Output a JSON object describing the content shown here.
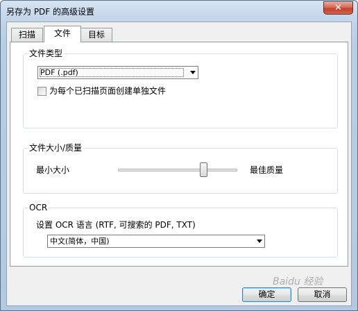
{
  "window": {
    "title": "另存为 PDF 的高级设置",
    "close_label": "✕"
  },
  "tabs": [
    {
      "label": "扫描"
    },
    {
      "label": "文件"
    },
    {
      "label": "目标"
    }
  ],
  "file_type": {
    "group_label": "文件类型",
    "select_value": "PDF (.pdf)",
    "checkbox_label": "为每个已扫描页面创建单独文件",
    "checkbox_checked": false
  },
  "size_quality": {
    "group_label": "文件大小/质量",
    "min_label": "最小大小",
    "max_label": "最佳质量",
    "slider_fraction": 0.72
  },
  "ocr": {
    "group_label": "OCR",
    "language_label": "设置 OCR 语言 (RTF, 可搜索的 PDF, TXT)",
    "language_value": "中文(简体，中国)"
  },
  "buttons": {
    "ok": "确定",
    "cancel": "取消"
  },
  "watermark": "Baidu 经验"
}
